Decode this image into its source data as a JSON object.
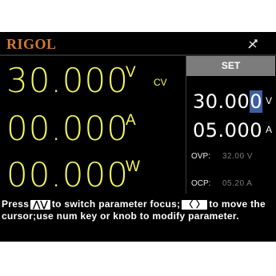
{
  "header": {
    "logo": "RIGOL",
    "status_icon": "no-network-icon"
  },
  "readouts": {
    "voltage": {
      "value": "30.000",
      "unit": "V"
    },
    "current": {
      "value": "00.000",
      "unit": "A"
    },
    "power": {
      "value": "00.000",
      "unit": "W"
    },
    "mode": "CV"
  },
  "set_panel": {
    "title": "SET",
    "voltage": {
      "value_main": "30.00",
      "value_cursor": "0",
      "unit": "V"
    },
    "current": {
      "value": "05.000",
      "unit": "A"
    },
    "ovp": {
      "label": "OVP:",
      "value": "32.00 V"
    },
    "ocp": {
      "label": "OCP:",
      "value": "05.20 A"
    }
  },
  "help": {
    "part1": "Press",
    "up_down_key": "⋀⋁",
    "part2": "to switch parameter focus;",
    "left_right_key": "〈 〉",
    "part3": "to move the cursor;use num key or knob to modify parameter."
  },
  "colors": {
    "readout": "#f3f55e",
    "logo": "#d27a34",
    "set_header": "#7c7c7c",
    "cursor": "#3d5ea0",
    "background": "#000000"
  }
}
